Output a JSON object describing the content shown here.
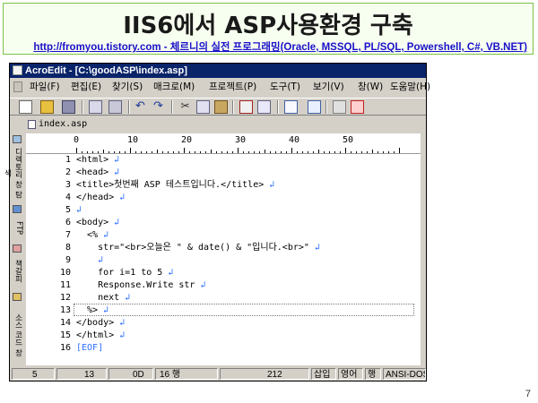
{
  "slide": {
    "title": "IIS6에서 ASP사용환경 구축",
    "subtitle": "http://fromyou.tistory.com - 체르니의 실전 프로그래밍(Oracle, MSSQL, PL/SQL, Powershell, C#, VB.NET)",
    "page_number": "7"
  },
  "window": {
    "title": "AcroEdit - [C:\\goodASP\\index.asp]",
    "menu": [
      "파일(F)",
      "편집(E)",
      "찾기(S)",
      "매크로(M)",
      "프로젝트(P)",
      "도구(T)",
      "보기(V)",
      "창(W)",
      "도움말(H)"
    ],
    "file_tab": "index.asp",
    "side_panel": [
      "디렉토리 창 탐색",
      "FTP",
      "책갈피",
      "소스 코드 창"
    ]
  },
  "ruler": [
    "0",
    "10",
    "20",
    "30",
    "40",
    "50"
  ],
  "code_lines": [
    {
      "no": "1",
      "text": "<html>"
    },
    {
      "no": "2",
      "text": "<head>"
    },
    {
      "no": "3",
      "text": "<title>첫번째 ASP 테스트입니다.</title>"
    },
    {
      "no": "4",
      "text": "</head>"
    },
    {
      "no": "5",
      "text": ""
    },
    {
      "no": "6",
      "text": "<body>"
    },
    {
      "no": "7",
      "text": "  <%"
    },
    {
      "no": "8",
      "text": "    str=\"<br>오늘은 \" & date() & \"입니다.<br>\""
    },
    {
      "no": "9",
      "text": ""
    },
    {
      "no": "10",
      "text": "    for i=1 to 5"
    },
    {
      "no": "11",
      "text": "    Response.Write str"
    },
    {
      "no": "12",
      "text": "    next"
    },
    {
      "no": "13",
      "text": "  %>"
    },
    {
      "no": "14",
      "text": "</body>"
    },
    {
      "no": "15",
      "text": "</html>"
    }
  ],
  "eof_line": {
    "no": "16",
    "text": "[EOF]"
  },
  "eol_mark": "↲",
  "status": {
    "col": "5",
    "line": "13",
    "hex": "0D",
    "lines": "16 행",
    "size": "212",
    "insert": "삽입",
    "lang": "영어",
    "line_mode": "행",
    "encoding": "ANSI-DOS"
  },
  "colors": {
    "title_bar": "#0a246a",
    "subtitle_link": "#1a10c8",
    "eol_marker": "#2b6fff",
    "slide_border": "#7cc24a"
  }
}
